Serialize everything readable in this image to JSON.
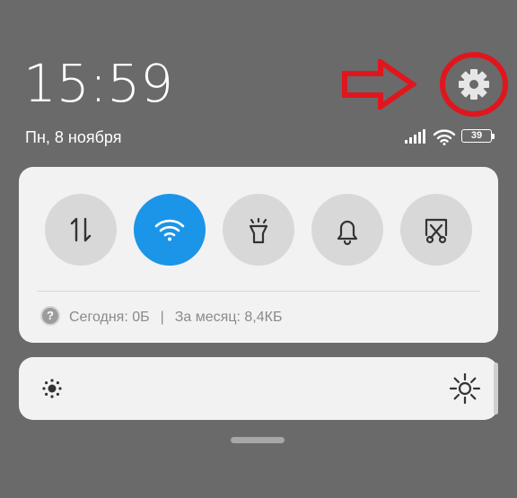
{
  "status": {
    "time": "15:59",
    "date": "Пн, 8 ноября",
    "battery_level": "39"
  },
  "quick_toggles": [
    {
      "name": "mobile-data",
      "icon": "data-transfer-icon",
      "active": false
    },
    {
      "name": "wifi",
      "icon": "wifi-icon",
      "active": true
    },
    {
      "name": "flashlight",
      "icon": "flashlight-icon",
      "active": false
    },
    {
      "name": "sound",
      "icon": "bell-icon",
      "active": false
    },
    {
      "name": "screenshot",
      "icon": "scissors-screenshot-icon",
      "active": false
    }
  ],
  "data_usage": {
    "help_glyph": "?",
    "today": "Сегодня: 0Б",
    "separator": "|",
    "month": "За месяц: 8,4КБ"
  },
  "colors": {
    "background": "#6a6a6a",
    "panel": "#f2f2f2",
    "toggle_active": "#1a95e8",
    "toggle_inactive": "#d8d8d8",
    "annotation": "#e0161e"
  }
}
